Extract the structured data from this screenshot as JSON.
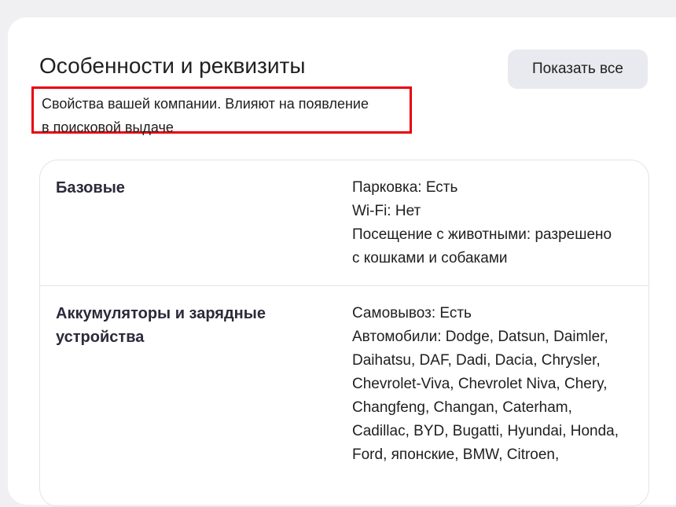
{
  "section": {
    "title": "Особенности и реквизиты",
    "subtitle_line1": "Свойства вашей компании. Влияют на появление",
    "subtitle_line2": "в поисковой выдаче",
    "show_all_label": "Показать все",
    "highlight_color": "#e8000f"
  },
  "groups": [
    {
      "name": "Базовые",
      "values": [
        "Парковка: Есть",
        "Wi-Fi: Нет",
        "Посещение с животными: разрешено",
        "с кошками и собаками"
      ]
    },
    {
      "name_line1": "Аккумуляторы и зарядные",
      "name_line2": "устройства",
      "values": [
        "Самовывоз: Есть",
        "Автомобили: Dodge, Datsun, Daimler,",
        "Daihatsu, DAF, Dadi, Dacia, Chrysler,",
        "Chevrolet-Viva, Chevrolet Niva, Chery,",
        "Changfeng, Changan, Caterham,",
        "Cadillac, BYD, Bugatti, Hyundai, Honda,",
        "Ford, японские, BMW, Citroen,"
      ]
    }
  ]
}
